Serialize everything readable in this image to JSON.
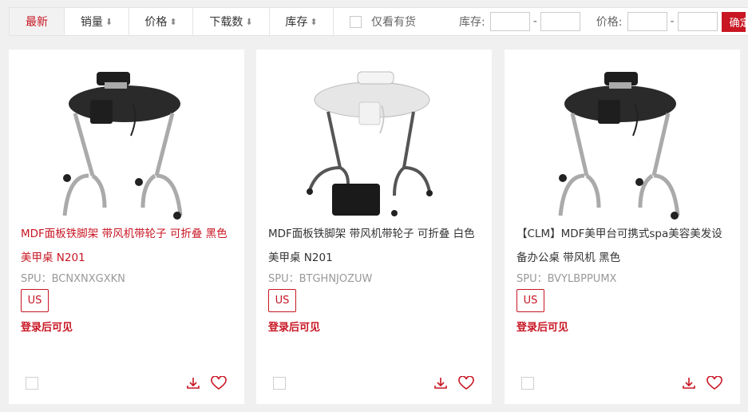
{
  "filter": {
    "tabs": [
      {
        "label": "最新",
        "arrow": ""
      },
      {
        "label": "销量",
        "arrow": "⬇"
      },
      {
        "label": "价格",
        "arrow": "⬍"
      },
      {
        "label": "下载数",
        "arrow": "⬇"
      },
      {
        "label": "库存",
        "arrow": "⬍"
      }
    ],
    "stock_only_label": "仅看有货",
    "stock_range_label": "库存:",
    "price_range_label": "价格:",
    "dash": "-",
    "confirm_label": "确定",
    "stock_min": "",
    "stock_max": "",
    "price_min": "",
    "price_max": ""
  },
  "products": [
    {
      "title": "MDF面板铁脚架 带风机带轮子 可折叠 黑色 美甲桌 N201",
      "spu": "SPU：BCNXNXGXKN",
      "badge": "US",
      "login_text": "登录后可见",
      "table_color": "#2a2a2a",
      "highlighted": true
    },
    {
      "title": "MDF面板铁脚架 带风机带轮子 可折叠 白色 美甲桌 N201",
      "spu": "SPU：BTGHNJOZUW",
      "badge": "US",
      "login_text": "登录后可见",
      "table_color": "#e6e6e6",
      "highlighted": false
    },
    {
      "title": "【CLM】MDF美甲台可携式spa美容美发设备办公桌 带风机 黑色",
      "spu": "SPU：BVYLBPPUMX",
      "badge": "US",
      "login_text": "登录后可见",
      "table_color": "#2a2a2a",
      "highlighted": false
    }
  ],
  "colors": {
    "accent": "#c81623"
  }
}
